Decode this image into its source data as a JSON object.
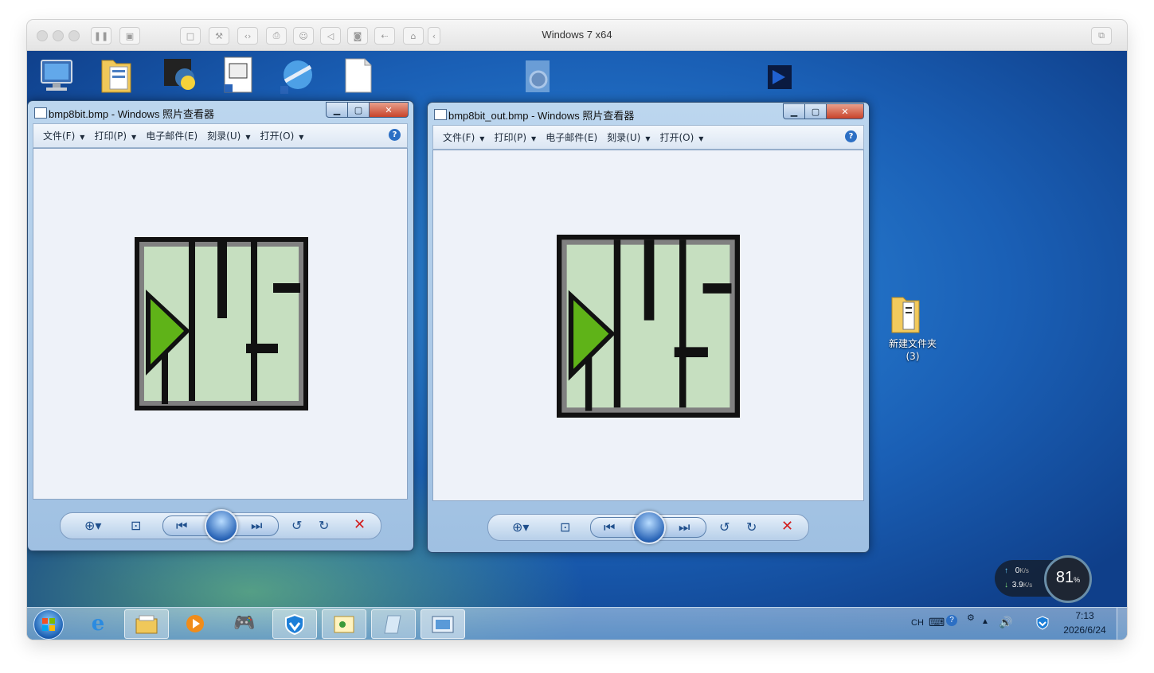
{
  "vm": {
    "title": "Windows 7 x64"
  },
  "desktop": {
    "folder_label": "新建文件夹",
    "folder_sublabel": "(3)"
  },
  "windows": [
    {
      "title": "bmp8bit.bmp - Windows 照片查看器",
      "menu": [
        "文件(F)",
        "打印(P)",
        "电子邮件(E)",
        "刻录(U)",
        "打开(O)"
      ],
      "menu_has_arrow": [
        true,
        true,
        false,
        true,
        true
      ]
    },
    {
      "title": "bmp8bit_out.bmp - Windows 照片查看器",
      "menu": [
        "文件(F)",
        "打印(P)",
        "电子邮件(E)",
        "刻录(U)",
        "打开(O)"
      ],
      "menu_has_arrow": [
        true,
        true,
        false,
        true,
        true
      ]
    }
  ],
  "tray": {
    "lang": "CH",
    "time": "7:13",
    "date": "2026/6/24"
  },
  "net": {
    "up_value": "0",
    "up_unit": "K/s",
    "down_value": "3.9",
    "down_unit": "K/s",
    "usage_value": "81",
    "usage_unit": "%"
  },
  "colors": {
    "image_light_green": "#c6dfc0",
    "image_dark": "#111111",
    "image_grey": "#808080",
    "image_arrow_green": "#5fb318"
  }
}
